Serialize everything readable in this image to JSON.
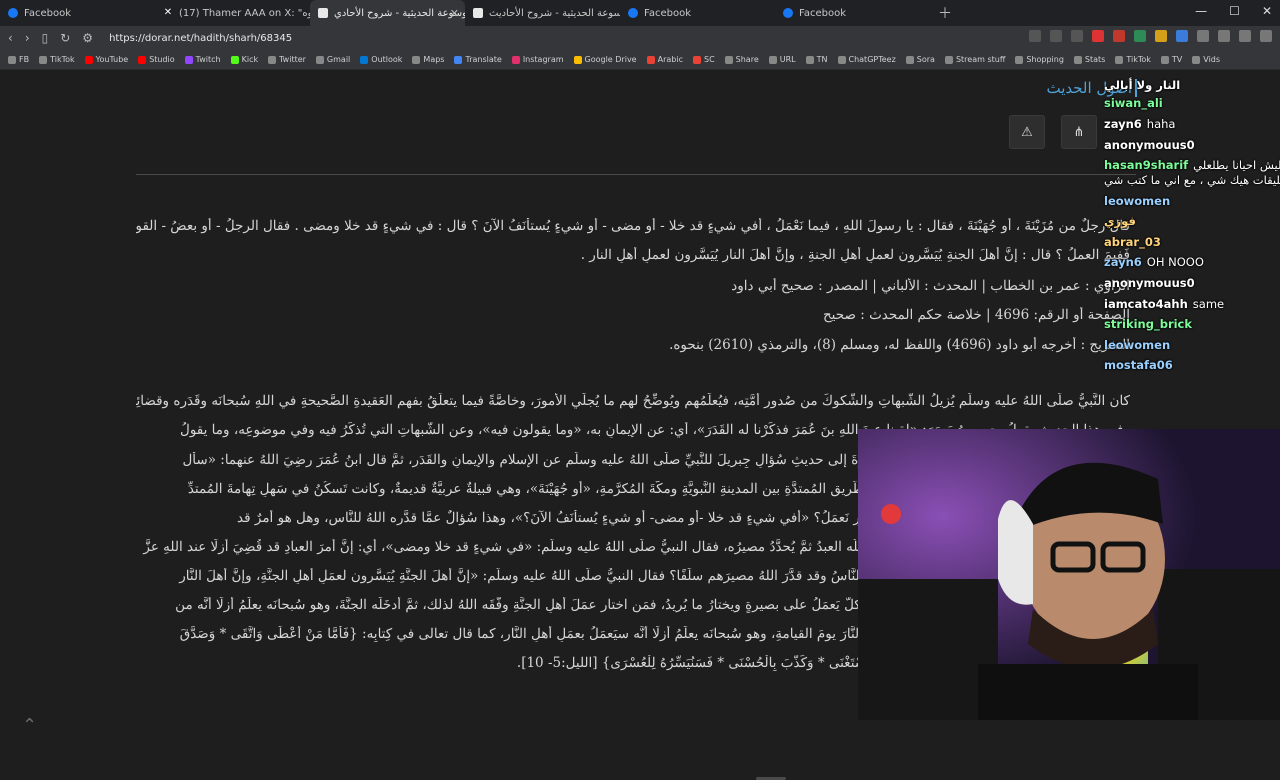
{
  "browser": {
    "tabs": [
      {
        "label": "Facebook",
        "icon": "facebook-icon",
        "active": false
      },
      {
        "label": "(17) Thamer AAA on X: \"جاك أمه وأبوه",
        "icon": "x-icon",
        "active": false
      },
      {
        "label": "الموسوعة الحديثية - شروح الأحادي",
        "icon": "page-icon",
        "active": true
      },
      {
        "label": "الموسوعة الحديثية - شروح الأحاديث -",
        "icon": "page-icon",
        "active": false
      },
      {
        "label": "Facebook",
        "icon": "facebook-icon",
        "active": false
      },
      {
        "label": "Facebook",
        "icon": "facebook-icon",
        "active": false
      }
    ],
    "url": "https://dorar.net/hadith/sharh/68345",
    "bookmarks": [
      {
        "label": "FB",
        "color": "#888888"
      },
      {
        "label": "TikTok",
        "color": "#888888"
      },
      {
        "label": "YouTube",
        "color": "#ff0000"
      },
      {
        "label": "Studio",
        "color": "#ff0000"
      },
      {
        "label": "Twitch",
        "color": "#9146ff"
      },
      {
        "label": "Kick",
        "color": "#53fc18"
      },
      {
        "label": "Twitter",
        "color": "#888888"
      },
      {
        "label": "Gmail",
        "color": "#888888"
      },
      {
        "label": "Outlook",
        "color": "#0078d4"
      },
      {
        "label": "Maps",
        "color": "#888888"
      },
      {
        "label": "Translate",
        "color": "#4285f4"
      },
      {
        "label": "Instagram",
        "color": "#e1306c"
      },
      {
        "label": "Google Drive",
        "color": "#fbbc04"
      },
      {
        "label": "Arabic",
        "color": "#ea4335"
      },
      {
        "label": "SC",
        "color": "#ea4335"
      },
      {
        "label": "Share",
        "color": "#888888"
      },
      {
        "label": "URL",
        "color": "#888888"
      },
      {
        "label": "TN",
        "color": "#888888"
      },
      {
        "label": "ChatGPTeez",
        "color": "#888888"
      },
      {
        "label": "Sora",
        "color": "#888888"
      },
      {
        "label": "Stream stuff",
        "color": "#888888"
      },
      {
        "label": "Shopping",
        "color": "#888888"
      },
      {
        "label": "Stats",
        "color": "#888888"
      },
      {
        "label": "TikTok",
        "color": "#888888"
      },
      {
        "label": "TV",
        "color": "#888888"
      },
      {
        "label": "Vids",
        "color": "#888888"
      }
    ]
  },
  "page": {
    "section_title": "أصول الحديث",
    "hadith_lines": [
      "قال رجلٌ من مُزَيْنَةَ ، أو جُهَيْنَةَ ، فقال : يا رسولَ اللهِ ، فيما نَعْمَلُ ، أفي شيءٍ قد خلا - أو مضى - أو شيءٍ يُستأنَفُ الآنَ ؟ قال : في شيءٍ قد خلا ومضى . فقال الرجلُ - أو بعضُ - القومِ :",
      "فَفِيمَ العملُ ؟ قال : إنَّ أهلَ الجنةِ يُيَسَّرون لعملِ أهلِ الجنةِ ، وإنَّ أهلَ النارِ يُيَسَّرون لعملِ أهلِ النارِ .",
      "الراوي : عمر بن الخطاب | المحدث : الألباني | المصدر : صحيح أبي داود",
      "الصفحة أو الرقم: 4696 | خلاصة حكم المحدث : صحيح",
      "التخريج : أخرجه أبو داود (4696) واللفظ له، ومسلم (8)، والترمذي (2610) بنحوه."
    ],
    "sharh_lines": [
      "كان النَّبيُّ صلَّى اللهُ عليه وسلَّم يُزيلُ الشُّبهاتِ والشُّكوكَ من صُدورِ أُمَّتِه، فيُعلِّمُهم ويُوضِّحُ لهم ما يُجلِّي الأمورَ، وخاصَّةً فيما يتعلَّقُ بفهمِ العَقيدةِ الصَّحيحةِ في اللهِ سُبحانَه وقَدَرِه وقضائِه.",
      "وفي هذا الحديثِ يقولُ يحيى بنُ يَعمَرَ: «لقِينا عبدَ اللهِ بنَ عُمَرَ فذكَرْنا له القَدَرَ»، أي: عن الإيمانِ به، «وما يقولون فيه»، وعن الشُّبهاتِ التي تُذكَرُ فيه وفي موضوعِه، وما يقولُ",
      "الناسُ فيه، فقصَّ عليهم الحديثَ، ويقصِدُ به الإشارةَ إلى حديثِ سُؤالِ جِبريلَ للنَّبيِّ صلَّى اللهُ عليه وسلَّم عن الإسلامِ والإيمانِ والقَدَرِ، ثمَّ قال ابنُ عُمَرَ رضِيَ اللهُ عنهما: «سأل",
      "رجلٌ من مُزَيْنَةَ»، وهي قبيلةٌ كانت منازِلُها على الطَّريقِ المُمتدَّةِ بين المدينةِ النَّبويَّةِ ومكَّةَ المُكرَّمةِ، «أو جُهَيْنَةَ»، وهي قبيلةٌ عربيَّةٌ قديمةٌ، وكانت تَسكُنُ في سَهلِ تِهامةَ المُمتدِّ",
      "فقال: يا رسولَ اللهِ، فيما نَعمَلُ؟»، أي: في أيِّ أمرٍ نَعمَلُ؟ «أفي شيءٍ قد خلا -أو مضى- أو شيءٍ يُستأنَفُ الآنَ؟»، وهذا سُؤالٌ عمَّا قدَّره اللهُ للنَّاسِ، وهل هو أمرٌ قد",
      "قُضِيَ وقُدِّرَ وسبَقَ العِلمُ به، أم هو أمرٌ على ما يَفعَلُه العبدُ ثمَّ يُحدَّدُ مصيرُه، فقال النبيُّ صلَّى اللهُ عليه وسلَّم: «في شيءٍ قد خلا ومضى»، أي: إنَّ أمرَ العبادِ قد قُضِيَ أزلًا عند اللهِ عزَّ",
      "وجلَّ، فقال الرجلُ -أو بعضُ القومِ-: فلماذا يَعمَلُ النَّاسُ وقد قدَّرَ اللهُ مصيرَهم سلَفًا؟ فقال النبيُّ صلَّى اللهُ عليه وسلَّم: «إنَّ أهلَ الجنَّةِ يُيَسَّرون لعمَلِ أهلِ الجنَّةِ، وإنَّ أهلَ النَّارِ",
      "يُيَسَّرون لعمَلِ أهلِ النَّارِ»، واللهُ مُحيطٌ بالجميعِ، فكلٌّ يَعمَلُ على بصيرةٍ ويختارُ ما يُريدُ، فمَن اختار عمَلَ أهلِ الجنَّةِ وفَّقَه اللهُ لذلك، ثمَّ أدخَلَه الجنَّةَ، وهو سُبحانَه يعلَمُ أزلًا أنَّه من",
      "أهلِ الجنَّةِ، ومَن اختار عمَلَ أهلِ النَّارِ حتَّى يُدخِلَه النَّارَ يومَ القيامةِ، وهو سُبحانَه يعلَمُ أزلًا أنَّه سيَعمَلُ بعمَلِ أهلِ النَّارِ، كما قال تعالى في كِتابِه: {فَأَمَّا مَنْ أَعْطَى وَاتَّقَى * وَصَدَّقَ",
      "بِالْحُسْنَى * فَسَنُيَسِّرُهُ لِلْيُسْرَى * وَأَمَّا مَنْ بَخِلَ وَاسْتَغْنَى * وَكَذَّبَ بِالْحُسْنَى * فَسَنُيَسِّرُهُ لِلْعُسْرَى} [الليل:5- 10]."
    ]
  },
  "chat": [
    {
      "user": "النار ولا أبالي",
      "msg": "",
      "color": "#ffffff"
    },
    {
      "user": "siwan_ali",
      "msg": "",
      "color": "#7cfc9a"
    },
    {
      "user": "zayn6",
      "msg": "haha",
      "color": "#ffffff"
    },
    {
      "user": "anonymouus0",
      "msg": "",
      "color": "#ffffff"
    },
    {
      "user": "hasan9sharif",
      "msg": "شباب ليش احيانا يطلعلي",
      "color": "#7cfc9a"
    },
    {
      "user": "",
      "msg": "تقييد بالتعليقات هيك شي ، مع اني ما كتب شي",
      "color": "#ffffff"
    },
    {
      "user": "leowomen",
      "msg": "",
      "color": "#9ad0ff"
    },
    {
      "user": "فوزي",
      "msg": "",
      "color": "#ffd479"
    },
    {
      "user": "abrar_03",
      "msg": "",
      "color": "#ffd479"
    },
    {
      "user": "zayn6",
      "msg": "OH NOOO",
      "color": "#9ad0ff"
    },
    {
      "user": "anonymouus0",
      "msg": "",
      "color": "#ffffff"
    },
    {
      "user": "iamcato4ahh",
      "msg": "same",
      "color": "#ffffff"
    },
    {
      "user": "striking_brick",
      "msg": "",
      "color": "#7cfc9a"
    },
    {
      "user": "leowomen",
      "msg": "",
      "color": "#9ad0ff"
    },
    {
      "user": "mostafa06",
      "msg": "",
      "color": "#9ad0ff"
    }
  ]
}
